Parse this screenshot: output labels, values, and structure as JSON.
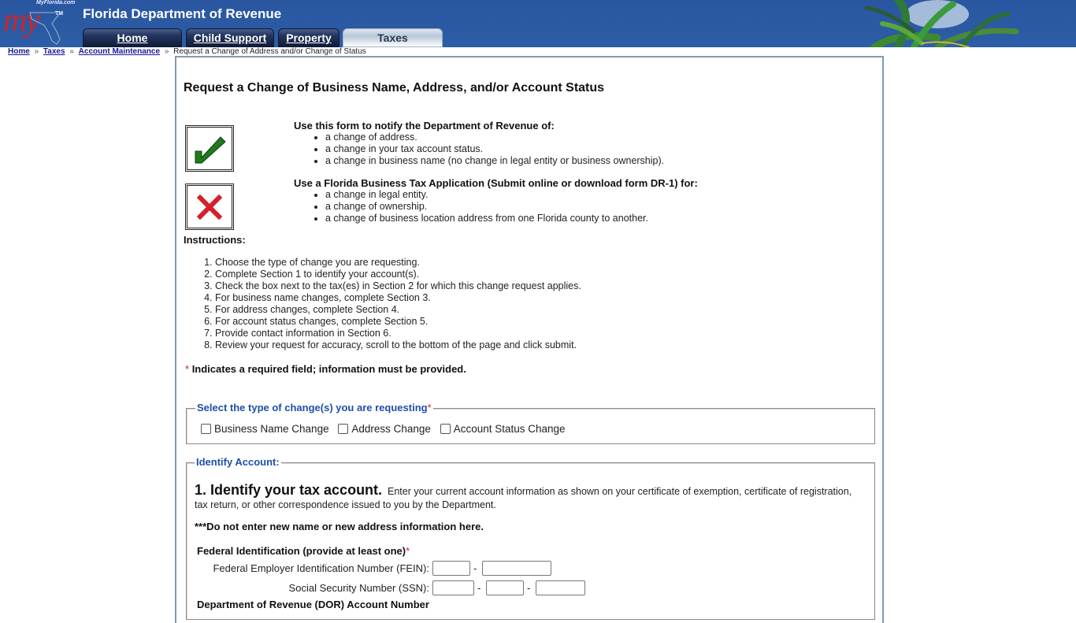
{
  "header": {
    "logo_small_text": "MyFlorida.com",
    "logo_text": "my",
    "logo_tm": "TM",
    "site_title": "Florida Department of Revenue",
    "tabs": [
      {
        "label": "Home",
        "active": false
      },
      {
        "label": "Child Support",
        "active": false
      },
      {
        "label": "Property",
        "active": false
      },
      {
        "label": "Taxes",
        "active": true
      }
    ]
  },
  "breadcrumb": {
    "links": [
      "Home",
      "Taxes",
      "Account Maintenance"
    ],
    "separator": "»",
    "current": "Request a Change of Address and/or Change of Status"
  },
  "page": {
    "title": "Request a Change of Business Name, Address, and/or Account Status",
    "use_form": {
      "icon": "checkmark-icon",
      "lead": "Use this form to notify the Department of Revenue of:",
      "items": [
        "a change of address.",
        "a change in your tax account status.",
        "a change in business name (no change in legal entity or business ownership)."
      ]
    },
    "use_application": {
      "icon": "x-mark-icon",
      "lead": "Use a Florida Business Tax Application (Submit online or download form DR-1) for:",
      "items": [
        "a change in legal entity.",
        "a change of ownership.",
        "a change of business location address from one Florida county to another."
      ]
    },
    "instructions_heading": "Instructions:",
    "instructions": [
      "Choose the type of change you are requesting.",
      "Complete Section 1 to identify your account(s).",
      "Check the box next to the tax(es) in Section 2 for which this change request applies.",
      "For business name changes, complete Section 3.",
      "For address changes, complete Section 4.",
      "For account status changes, complete Section 5.",
      "Provide contact information in Section 6.",
      "Review your request for accuracy, scroll to the bottom of the page and click submit."
    ],
    "required_star": "*",
    "required_note": "Indicates a required field; information must be provided.",
    "change_type": {
      "legend": "Select the type of change(s) you are requesting",
      "options": [
        {
          "label": "Business Name Change",
          "checked": false
        },
        {
          "label": "Address Change",
          "checked": false
        },
        {
          "label": "Account Status Change",
          "checked": false
        }
      ]
    },
    "identify": {
      "legend": "Identify Account:",
      "section_title": "1. Identify your tax account.",
      "section_desc": "Enter your current account information as shown on your certificate of exemption, certificate of registration, tax return, or other correspondence issued to you by the Department.",
      "warning": "***Do not enter new name or new address information here.",
      "fed_id_heading": "Federal Identification (provide at least one)",
      "fein_label": "Federal Employer Identification Number (FEIN):",
      "fein_values": [
        "",
        ""
      ],
      "ssn_label": "Social Security Number (SSN):",
      "ssn_values": [
        "",
        "",
        ""
      ],
      "dash": "-",
      "dor_label": "Department of Revenue (DOR) Account Number"
    }
  },
  "colors": {
    "header_blue": "#2b5aa3",
    "legend_blue": "#1e4fa8",
    "required_red": "#cc2222",
    "check_green": "#1f7a1f",
    "x_red": "#d4202a"
  }
}
